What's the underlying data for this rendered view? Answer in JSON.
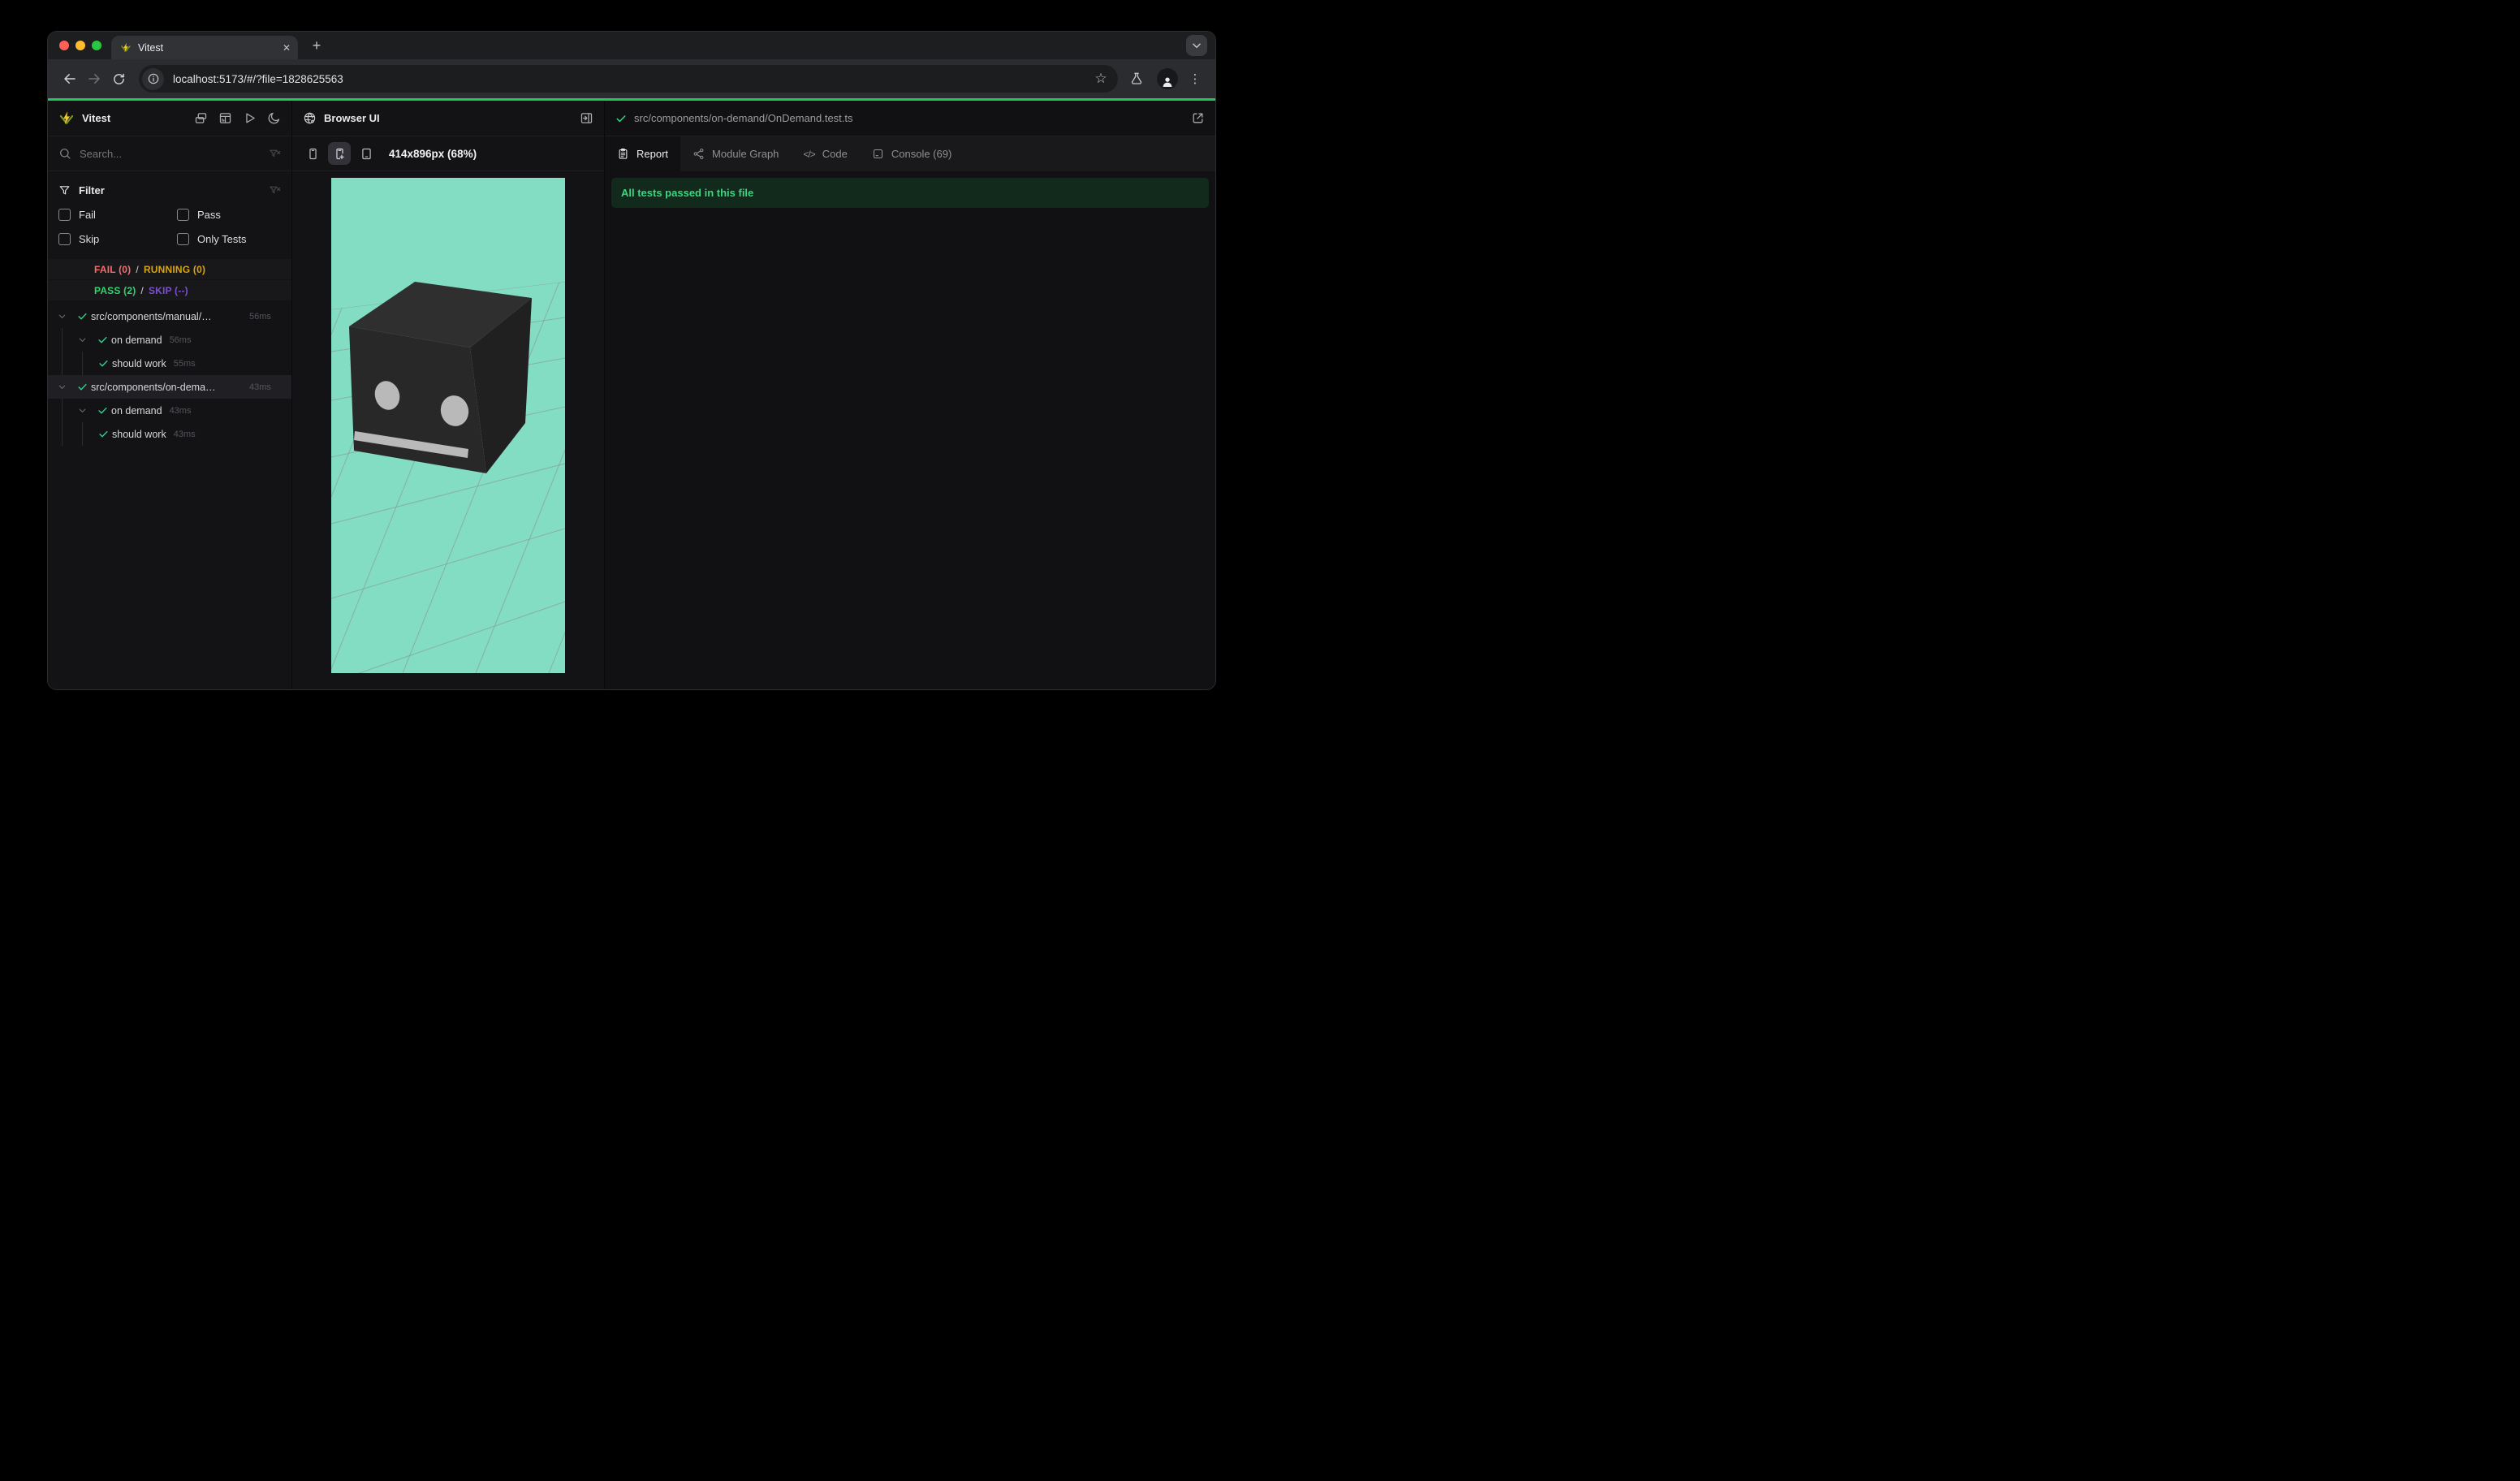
{
  "colors": {
    "accent_green": "#22c55e",
    "mint_background": "#82ddc2",
    "cube_top": "#2f2f2f",
    "cube_front": "#282828",
    "cube_side": "#202020",
    "eyes_gray": "#b9b9b9",
    "fail": "#f56c6c",
    "running": "#d9a40d",
    "pass": "#2ed46e",
    "skip": "#7c4fd0",
    "banner_bg": "#122a1c",
    "banner_text": "#3bd57f"
  },
  "icons": {
    "close": "✕",
    "plus": "+",
    "kebab": "⋮",
    "star": "☆",
    "code": "</>"
  },
  "browser": {
    "tab_title": "Vitest",
    "url": "localhost:5173/#/?file=1828625563"
  },
  "sidebar": {
    "title": "Vitest",
    "search_placeholder": "Search...",
    "filter": {
      "title": "Filter",
      "options": [
        "Fail",
        "Pass",
        "Skip",
        "Only Tests"
      ]
    },
    "summary": {
      "fail": "FAIL (0)",
      "running": "RUNNING (0)",
      "pass": "PASS (2)",
      "skip": "SKIP (--)",
      "separator": "/"
    },
    "tree": [
      {
        "label": "src/components/manual/…",
        "duration": "56ms"
      },
      {
        "label": "on demand",
        "duration": "56ms"
      },
      {
        "label": "should work",
        "duration": "55ms"
      },
      {
        "label": "src/components/on-dema…",
        "duration": "43ms"
      },
      {
        "label": "on demand",
        "duration": "43ms"
      },
      {
        "label": "should work",
        "duration": "43ms"
      }
    ]
  },
  "middle": {
    "title": "Browser UI",
    "viewport_size": "414x896px (68%)"
  },
  "right": {
    "file_path": "src/components/on-demand/OnDemand.test.ts",
    "tabs": [
      "Report",
      "Module Graph",
      "Code",
      "Console (69)"
    ],
    "banner": "All tests passed in this file"
  }
}
